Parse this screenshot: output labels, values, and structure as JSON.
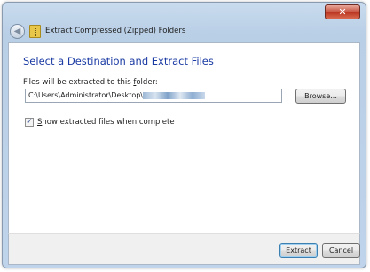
{
  "titlebar": {
    "close_icon": "close-icon",
    "close_glyph": "✕",
    "back_glyph": "◀",
    "wizard_title": "Extract Compressed (Zipped) Folders"
  },
  "main": {
    "heading": "Select a Destination and Extract Files",
    "path_label": "Files will be extracted to this folder:",
    "path_value": "C:\\Users\\Administrator\\Desktop\\",
    "browse_label": "Browse...",
    "checkbox": {
      "label": "Show extracted files when complete",
      "checked": true,
      "glyph": "✓"
    }
  },
  "footer": {
    "extract_label": "Extract",
    "cancel_label": "Cancel"
  },
  "colors": {
    "heading": "#1a3aa3",
    "frame": "#bfd4ea",
    "close": "#c7513f"
  }
}
